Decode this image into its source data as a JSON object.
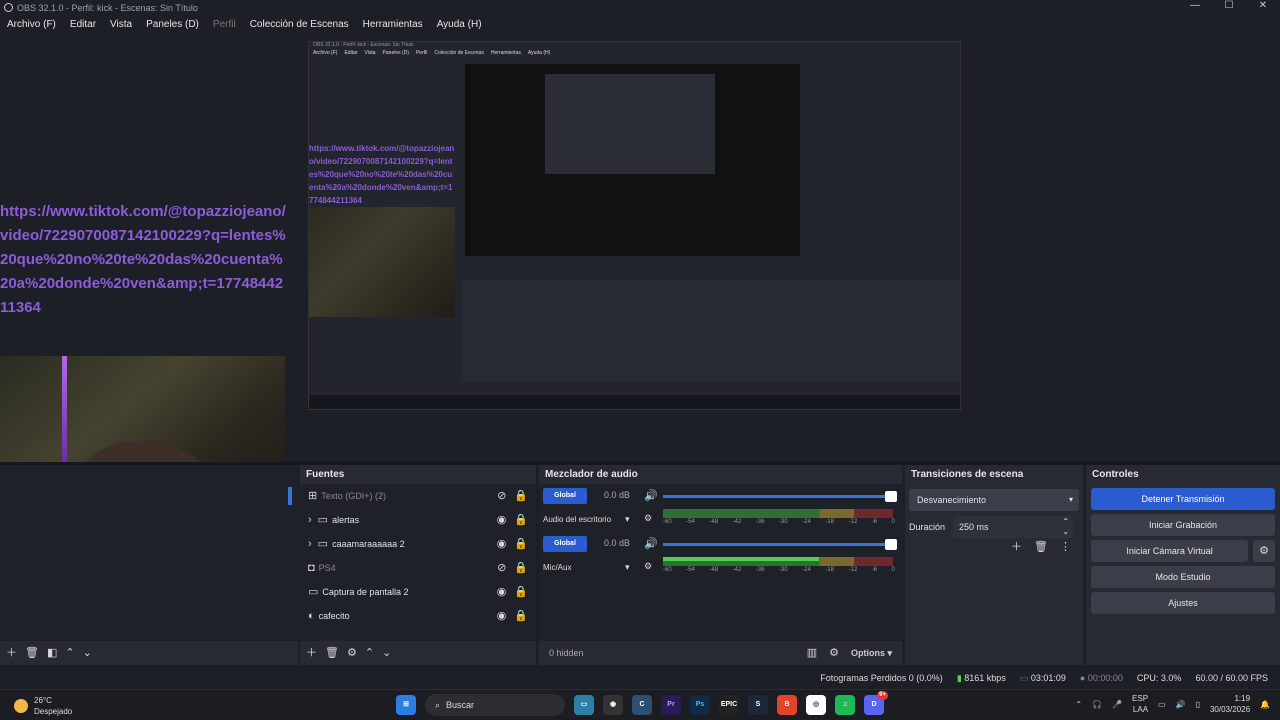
{
  "window": {
    "title": "OBS 32.1.0 - Perfil: kick - Escenas: Sin Título"
  },
  "menu": [
    "Archivo (F)",
    "Editar",
    "Vista",
    "Paneles (D)",
    "Perfil",
    "Colección de Escenas",
    "Herramientas",
    "Ayuda (H)"
  ],
  "preview": {
    "url_text": "https://www.tiktok.com/@topazziojeano/video/7229070087142100229?q=lentes%20que%20no%20te%20das%20cuenta%20a%20donde%20ven&amp;t=1774844211364",
    "nested_url_text": "https://www.tiktok.com/@topazziojeano/video/7229070087142100229?q=lentes%20que%20no%20te%20das%20cuenta%20a%20donde%20ven&amp;t=1774844211364"
  },
  "sources": {
    "header": "Fuentes",
    "items": [
      {
        "label": "Texto (GDI+) (2)",
        "icon": "text-icon",
        "hidden": true
      },
      {
        "label": "alertas",
        "icon": "folder-icon",
        "hidden": false,
        "group": true
      },
      {
        "label": "caaamaraaaaaa 2",
        "icon": "folder-icon",
        "hidden": false,
        "group": true
      },
      {
        "label": "PS4",
        "icon": "camera-icon",
        "hidden": true
      },
      {
        "label": "Captura de pantalla 2",
        "icon": "monitor-icon",
        "hidden": false
      },
      {
        "label": "cafecito",
        "icon": "globe-icon",
        "hidden": false
      }
    ]
  },
  "mixer": {
    "header": "Mezclador de audio",
    "channels": [
      {
        "badge": "Global",
        "db": "0.0 dB",
        "label": "Audio del escritorio"
      },
      {
        "badge": "Global",
        "db": "0.0 dB",
        "label": "Mic/Aux"
      }
    ],
    "scale": [
      "-60",
      "-54",
      "-48",
      "-42",
      "-36",
      "-30",
      "-24",
      "-18",
      "-12",
      "-6",
      "0"
    ],
    "hidden_count": "0 hidden",
    "options": "Options"
  },
  "transitions": {
    "header": "Transiciones de escena",
    "selected": "Desvanecimiento",
    "duration_label": "Duración",
    "duration_value": "250 ms"
  },
  "controls": {
    "header": "Controles",
    "stop_stream": "Detener Transmisión",
    "start_recording": "Iniciar Grabación",
    "start_virtual_cam": "Iniciar Cámara Virtual",
    "studio_mode": "Modo Estudio",
    "settings": "Ajustes"
  },
  "status": {
    "dropped": "Fotogramas Perdidos 0 (0.0%)",
    "bitrate": "8161 kbps",
    "stream_time": "03:01:09",
    "rec_time": "00:00:00",
    "cpu": "CPU: 3.0%",
    "fps": "60.00 / 60.00 FPS"
  },
  "taskbar": {
    "temp": "26°C",
    "weather": "Despejado",
    "search": "Buscar",
    "lang1": "ESP",
    "lang2": "LAA",
    "time": "1:19",
    "date": "30/03/2026",
    "discord_badge": "9+"
  },
  "colors": {
    "accent": "#2b5ccf",
    "url_purple": "#8e5bdc"
  }
}
